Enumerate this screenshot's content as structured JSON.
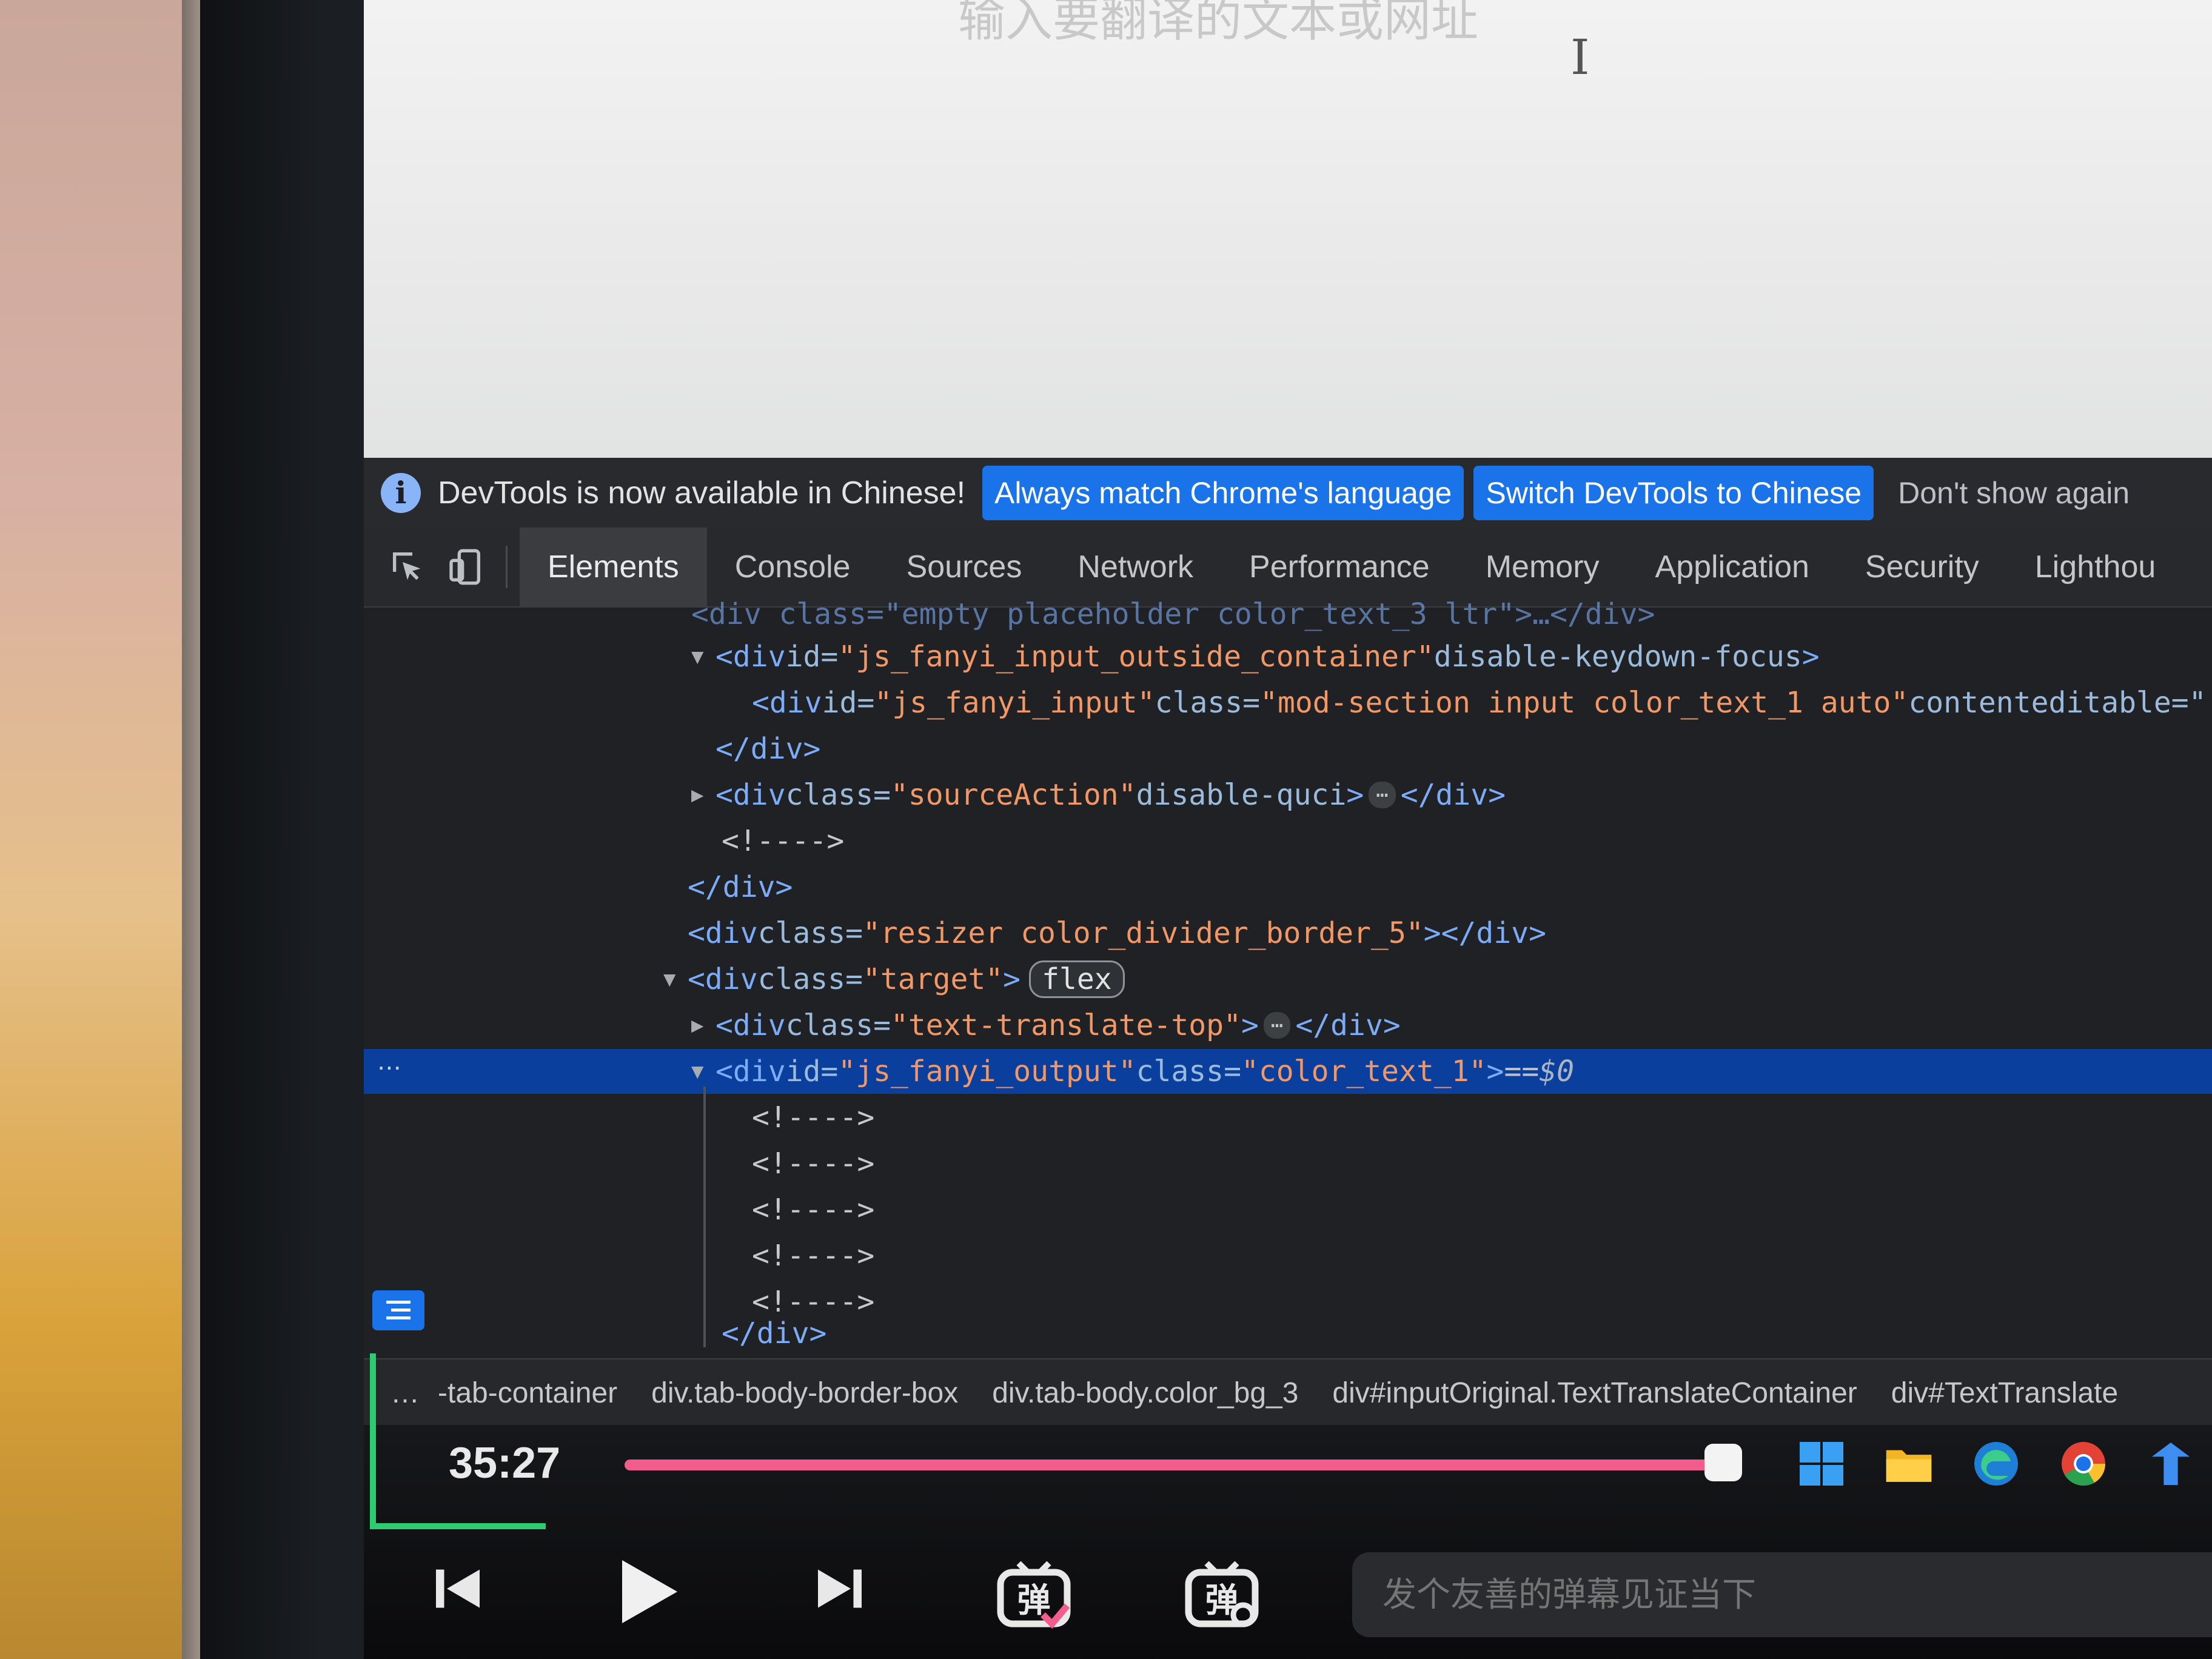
{
  "page": {
    "placeholder": "输入要翻译的文本或网址"
  },
  "infobar": {
    "message": "DevTools is now available in Chinese!",
    "btn_match": "Always match Chrome's language",
    "btn_switch": "Switch DevTools to Chinese",
    "dont_show": "Don't show again"
  },
  "tabs": [
    "Elements",
    "Console",
    "Sources",
    "Network",
    "Performance",
    "Memory",
    "Application",
    "Security",
    "Lighthou"
  ],
  "dom": {
    "l0": "<div class=\"empty placeholder color_text_3 ltr\">…</div>",
    "l1_tag": "<div",
    "l1_attr1": " id=",
    "l1_val1": "\"js_fanyi_input_outside_container\"",
    "l1_attr2": " disable-keydown-focus",
    "l1_end": ">",
    "l2_tag": "<div",
    "l2_attr1": " id=",
    "l2_val1": "\"js_fanyi_input\"",
    "l2_attr2": " class=",
    "l2_val2": "\"mod-section input color_text_1 auto\"",
    "l2_attr3": " contenteditable=\"",
    "l3": "</div>",
    "l4_tag": "<div",
    "l4_attr": " class=",
    "l4_val": "\"sourceAction\"",
    "l4_attr2": " disable-quci",
    "l4_open": ">",
    "l4_close": "</div>",
    "l5": "<!---->",
    "l6": "</div>",
    "l7_tag": "<div",
    "l7_attr": " class=",
    "l7_val": "\"resizer color_divider_border_5\"",
    "l7_end": "></div>",
    "l8_tag": "<div",
    "l8_attr": " class=",
    "l8_val": "\"target\"",
    "l8_end": ">",
    "l8_badge": "flex",
    "l9_tag": "<div",
    "l9_attr": " class=",
    "l9_val": "\"text-translate-top\"",
    "l9_open": ">",
    "l9_close": "</div>",
    "l10_tag": "<div",
    "l10_attr1": " id=",
    "l10_val1": "\"js_fanyi_output\"",
    "l10_attr2": " class=",
    "l10_val2": "\"color_text_1\"",
    "l10_end": ">",
    "l10_eq": " == ",
    "l10_dollar": "$0",
    "comment": "<!---->",
    "l16": "</div>",
    "ellipsis": "⋯",
    "dots": "⋯"
  },
  "breadcrumb": [
    "…",
    "-tab-container",
    "div.tab-body-border-box",
    "div.tab-body.color_bg_3",
    "div#inputOriginal.TextTranslateContainer",
    "div#TextTranslate"
  ],
  "player": {
    "time": "35:27",
    "progress": 0.985,
    "danmaku_placeholder": "发个友善的弹幕见证当下",
    "dm_label_1": "弹",
    "dm_label_2": "弹"
  },
  "colors": {
    "accent": "#1a73e8",
    "selected_row": "#0a3f9e",
    "progress": "#f25d8e",
    "green_mark": "#2ecc71"
  }
}
